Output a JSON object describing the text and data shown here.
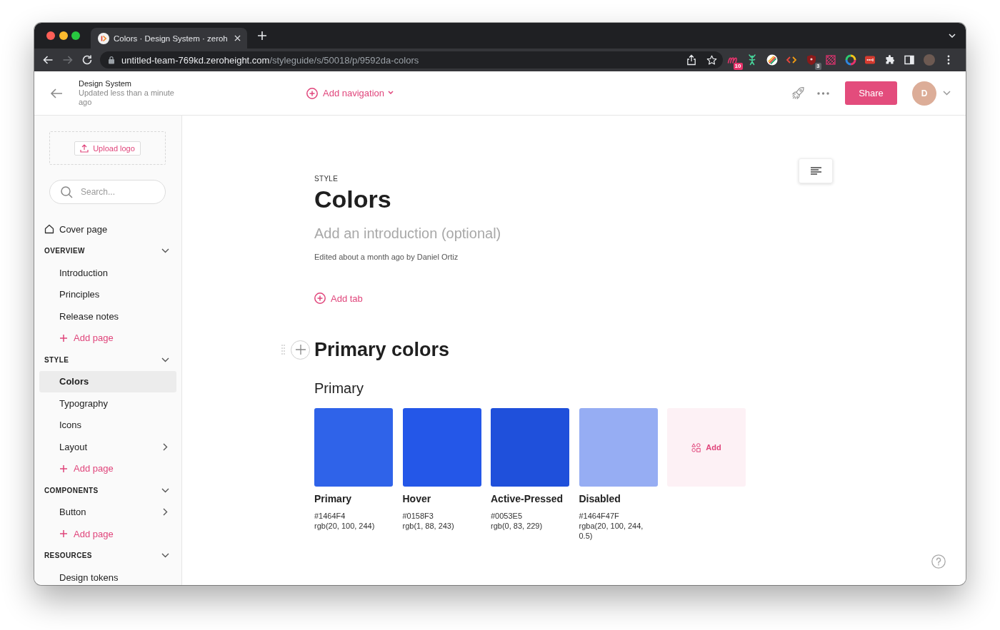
{
  "browser": {
    "tab": {
      "title": "Colors · Design System · zeroh"
    },
    "forward_disabled": true,
    "url": {
      "host": "untitled-team-769kd.zeroheight.com",
      "path": "/styleguide/s/50018/p/9592da-colors"
    },
    "extensions": [
      {
        "kind": "script",
        "badge": "10"
      },
      {
        "kind": "figure"
      },
      {
        "kind": "wheel"
      },
      {
        "kind": "code"
      },
      {
        "kind": "shield",
        "badge": "3"
      },
      {
        "kind": "grid"
      },
      {
        "kind": "ring"
      },
      {
        "kind": "dots"
      },
      {
        "kind": "puzzle"
      },
      {
        "kind": "panel"
      }
    ]
  },
  "header": {
    "title": "Design System",
    "subtitle": "Updated less than a minute ago",
    "add_navigation": "Add navigation",
    "share": "Share",
    "avatar_initial": "D"
  },
  "sidebar": {
    "upload_logo": "Upload logo",
    "search": {
      "placeholder": "Search..."
    },
    "cover_page": "Cover page",
    "sections": [
      {
        "title": "OVERVIEW",
        "expanded": true,
        "items": [
          {
            "label": "Introduction",
            "selected": false,
            "has_children": false
          },
          {
            "label": "Principles",
            "selected": false,
            "has_children": false
          },
          {
            "label": "Release notes",
            "selected": false,
            "has_children": false
          }
        ],
        "add_page": "Add page"
      },
      {
        "title": "STYLE",
        "expanded": true,
        "items": [
          {
            "label": "Colors",
            "selected": true,
            "has_children": false
          },
          {
            "label": "Typography",
            "selected": false,
            "has_children": false
          },
          {
            "label": "Icons",
            "selected": false,
            "has_children": false
          },
          {
            "label": "Layout",
            "selected": false,
            "has_children": true
          }
        ],
        "add_page": "Add page"
      },
      {
        "title": "COMPONENTS",
        "expanded": true,
        "items": [
          {
            "label": "Button",
            "selected": false,
            "has_children": true
          }
        ],
        "add_page": "Add page"
      },
      {
        "title": "RESOURCES",
        "expanded": true,
        "items": [
          {
            "label": "Design tokens",
            "selected": false,
            "has_children": false
          }
        ]
      }
    ]
  },
  "page": {
    "eyebrow": "STYLE",
    "title": "Colors",
    "intro": {
      "placeholder": "Add an introduction (optional)"
    },
    "edited": "Edited about a month ago by Daniel Ortiz",
    "add_tab": "Add tab",
    "sections": [
      {
        "title": "Primary colors",
        "groups": [
          {
            "title": "Primary",
            "add_label": "Add",
            "swatches": [
              {
                "name": "Primary",
                "hex": "#1464F4",
                "rgb": "rgb(20, 100, 244)",
                "color": "#2f63e9"
              },
              {
                "name": "Hover",
                "hex": "#0158F3",
                "rgb": "rgb(1, 88, 243)",
                "color": "#2457e8"
              },
              {
                "name": "Active-Pressed",
                "hex": "#0053E5",
                "rgb": "rgb(0, 83, 229)",
                "color": "#1f50db"
              },
              {
                "name": "Disabled",
                "hex": "#1464F47F",
                "rgb": "rgba(20, 100, 244, 0.5)",
                "color": "#96adf3"
              }
            ]
          }
        ]
      }
    ]
  }
}
